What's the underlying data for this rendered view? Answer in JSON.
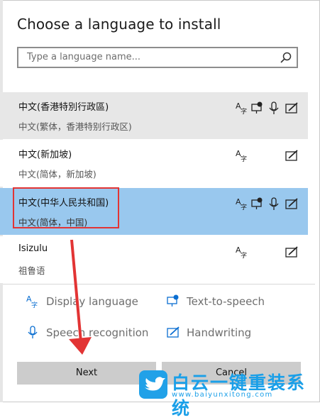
{
  "dialog": {
    "title": "Choose a language to install",
    "search_placeholder": "Type a language name..."
  },
  "languages": [
    {
      "name": "中文(香港特別行政區)",
      "native": "中文(繁体，香港特别行政区)",
      "features": [
        "display-language",
        "text-to-speech",
        "speech-recognition",
        "handwriting"
      ],
      "state": "hover"
    },
    {
      "name": "中文(新加坡)",
      "native": "中文(简体，新加坡)",
      "features": [
        "display-language",
        "handwriting"
      ],
      "state": "normal"
    },
    {
      "name": "中文(中华人民共和国)",
      "native": "中文(简体，中国)",
      "features": [
        "display-language",
        "text-to-speech",
        "speech-recognition",
        "handwriting"
      ],
      "state": "selected"
    },
    {
      "name": "Isizulu",
      "native": "祖鲁语",
      "features": [
        "display-language",
        "handwriting"
      ],
      "state": "normal"
    }
  ],
  "legend": {
    "display_language": "Display language",
    "text_to_speech": "Text-to-speech",
    "speech_recognition": "Speech recognition",
    "handwriting": "Handwriting"
  },
  "buttons": {
    "next": "Next",
    "cancel": "Cancel"
  },
  "watermark": {
    "main": "白云一键重装系统",
    "sub": "www.baiyunxitong.com"
  },
  "colors": {
    "selected_row": "#99c8ee",
    "hover_row": "#e7e7e7",
    "annotation_red": "#e23434",
    "accent_blue": "#0a6ed1",
    "watermark_blue": "#1a9fe8"
  }
}
